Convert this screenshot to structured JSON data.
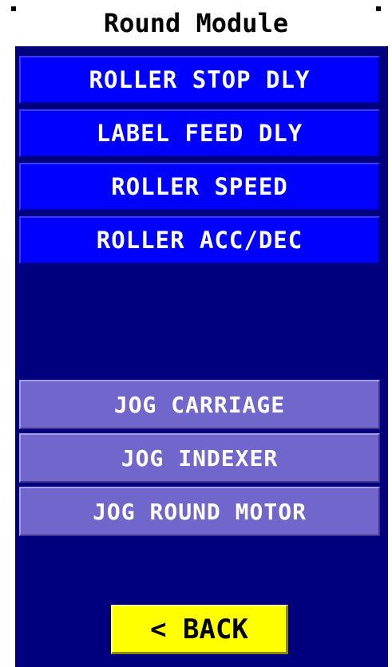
{
  "title": "Round Module",
  "settings_buttons": [
    {
      "label": "ROLLER STOP DLY"
    },
    {
      "label": "LABEL FEED DLY"
    },
    {
      "label": "ROLLER SPEED"
    },
    {
      "label": "ROLLER ACC/DEC"
    }
  ],
  "jog_buttons": [
    {
      "label": "JOG CARRIAGE"
    },
    {
      "label": "JOG INDEXER"
    },
    {
      "label": "JOG ROUND MOTOR"
    }
  ],
  "back_button": {
    "label": "< BACK"
  },
  "colors": {
    "panel_background": "#00007f",
    "settings_button": "#0000ff",
    "jog_button": "#7066cc",
    "back_button": "#ffff00"
  }
}
